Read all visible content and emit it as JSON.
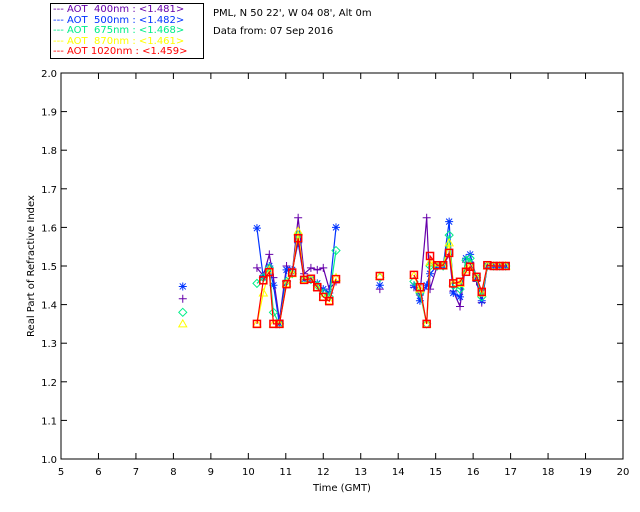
{
  "header": {
    "site": "PML, N 50 22', W 04 08', Alt 0m",
    "date": "Data from: 07 Sep 2016"
  },
  "chart_data": {
    "type": "scatter",
    "xlabel": "Time (GMT)",
    "ylabel": "Real Part of Refractive Index",
    "xlim": [
      5,
      20
    ],
    "ylim": [
      1.0,
      2.0
    ],
    "xticks": [
      "5",
      "6",
      "7",
      "8",
      "9",
      "10",
      "11",
      "12",
      "13",
      "14",
      "15",
      "16",
      "17",
      "18",
      "19",
      "20"
    ],
    "yticks": [
      "1.0",
      "1.1",
      "1.2",
      "1.3",
      "1.4",
      "1.5",
      "1.6",
      "1.7",
      "1.8",
      "1.9",
      "2.0"
    ],
    "legend_position": "top-left, outside",
    "x": [
      8.25,
      10.23,
      10.4,
      10.56,
      10.67,
      10.83,
      11.02,
      11.17,
      11.33,
      11.49,
      11.67,
      11.84,
      12.0,
      12.16,
      12.34,
      13.51,
      14.42,
      14.58,
      14.76,
      14.85,
      15.04,
      15.2,
      15.36,
      15.47,
      15.65,
      15.81,
      15.92,
      16.09,
      16.23,
      16.38,
      16.55,
      16.71,
      16.87
    ],
    "series": [
      {
        "name": "AOT  400nm : <1.481>",
        "color": "#6600aa",
        "marker": "plus",
        "values": [
          1.415,
          1.495,
          1.475,
          1.53,
          1.47,
          1.36,
          1.5,
          1.48,
          1.625,
          1.48,
          1.495,
          1.49,
          1.495,
          1.44,
          1.46,
          1.44,
          1.445,
          1.425,
          1.625,
          1.44,
          1.5,
          1.5,
          1.53,
          1.435,
          1.395,
          1.51,
          1.51,
          1.46,
          1.405,
          1.5,
          1.5,
          1.5,
          1.5
        ]
      },
      {
        "name": "AOT  500nm : <1.482>",
        "color": "#0033ff",
        "marker": "asterisk",
        "values": [
          1.447,
          1.598,
          1.47,
          1.5,
          1.45,
          1.35,
          1.49,
          1.49,
          1.56,
          1.465,
          1.465,
          1.455,
          1.44,
          1.43,
          1.6,
          1.45,
          1.45,
          1.41,
          1.45,
          1.48,
          1.5,
          1.5,
          1.615,
          1.43,
          1.42,
          1.52,
          1.53,
          1.47,
          1.41,
          1.5,
          1.5,
          1.5,
          1.5
        ]
      },
      {
        "name": "AOT  675nm : <1.468>",
        "color": "#00ee88",
        "marker": "diamond",
        "values": [
          1.38,
          1.455,
          1.47,
          1.495,
          1.38,
          1.35,
          1.46,
          1.48,
          1.58,
          1.465,
          1.465,
          1.45,
          1.43,
          1.42,
          1.54,
          1.47,
          1.46,
          1.43,
          1.35,
          1.5,
          1.5,
          1.5,
          1.58,
          1.45,
          1.44,
          1.515,
          1.52,
          1.47,
          1.42,
          1.5,
          1.5,
          1.5,
          1.5
        ]
      },
      {
        "name": "AOT  870nm : <1.461>",
        "color": "#ffff00",
        "marker": "triangle",
        "values": [
          1.35,
          1.35,
          1.43,
          1.49,
          1.35,
          1.35,
          1.455,
          1.48,
          1.59,
          1.465,
          1.465,
          1.445,
          1.42,
          1.41,
          1.47,
          1.474,
          1.475,
          1.44,
          1.35,
          1.51,
          1.5,
          1.5,
          1.56,
          1.455,
          1.455,
          1.49,
          1.5,
          1.47,
          1.43,
          1.5,
          1.5,
          1.5,
          1.5
        ]
      },
      {
        "name": "AOT 1020nm : <1.459>",
        "color": "#ff0000",
        "marker": "square",
        "values": [
          null,
          1.35,
          1.463,
          1.484,
          1.35,
          1.35,
          1.453,
          1.483,
          1.572,
          1.464,
          1.467,
          1.445,
          1.42,
          1.409,
          1.466,
          1.474,
          1.477,
          1.445,
          1.35,
          1.526,
          1.502,
          1.502,
          1.534,
          1.455,
          1.459,
          1.485,
          1.498,
          1.472,
          1.433,
          1.502,
          1.5,
          1.5,
          1.5
        ]
      }
    ]
  }
}
